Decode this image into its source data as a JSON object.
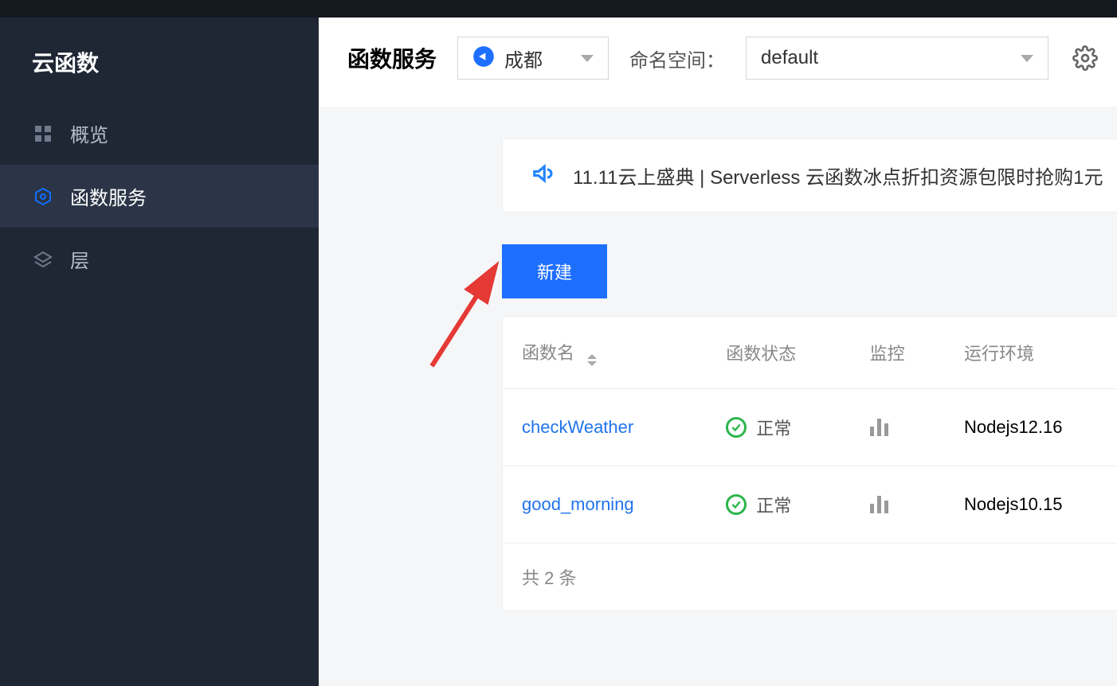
{
  "sidebar": {
    "title": "云函数",
    "items": [
      {
        "label": "概览",
        "icon": "dashboard-icon",
        "active": false
      },
      {
        "label": "函数服务",
        "icon": "hexagon-icon",
        "active": true
      },
      {
        "label": "层",
        "icon": "layers-icon",
        "active": false
      }
    ]
  },
  "header": {
    "page_title": "函数服务",
    "region_selected": "成都",
    "namespace_label": "命名空间：",
    "namespace_selected": "default"
  },
  "notice": {
    "text": "11.11云上盛典 | Serverless 云函数冰点折扣资源包限时抢购1元"
  },
  "actions": {
    "new_label": "新建"
  },
  "table": {
    "columns": {
      "name": "函数名",
      "status": "函数状态",
      "monitor": "监控",
      "runtime": "运行环境"
    },
    "rows": [
      {
        "name": "checkWeather",
        "status": "正常",
        "runtime": "Nodejs12.16"
      },
      {
        "name": "good_morning",
        "status": "正常",
        "runtime": "Nodejs10.15"
      }
    ],
    "footer_prefix": "共",
    "footer_count": "2",
    "footer_suffix": "条"
  }
}
